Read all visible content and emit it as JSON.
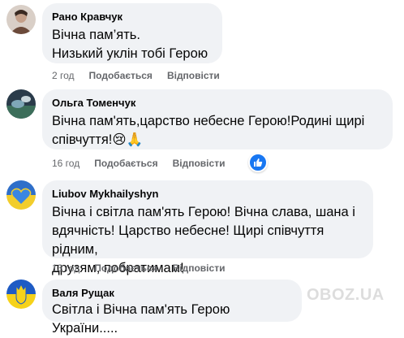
{
  "comments": [
    {
      "author": "Рано Кравчук",
      "lines": [
        "Вічна пам’ять.",
        "Низький уклін тобі Герою"
      ],
      "time": "2 год",
      "like_label": "Подобається",
      "reply_label": "Відповісти"
    },
    {
      "author": "Ольга Томенчук",
      "lines": [
        "Вічна пам'ять,царство небесне Герою!Родині щирі",
        "співчуття!😢🙏"
      ],
      "time": "16 год",
      "like_label": "Подобається",
      "reply_label": "Відповісти",
      "reaction_icon": "thumbs-up-icon"
    },
    {
      "author": "Liubov Mykhailyshyn",
      "lines": [
        "Вічна і світла пам'ять Герою! Вічна слава, шана і",
        "вдячність! Царство небесне! Щирі співчуття рідним,",
        "друзям, побратимам!"
      ],
      "time": "13 год",
      "like_label": "Подобається",
      "reply_label": "Відповісти"
    },
    {
      "author": "Валя Рущак",
      "lines": [
        "Світла і Вічна пам'ять Герою України....."
      ]
    }
  ],
  "watermark": "OBOZ.UA",
  "colors": {
    "bubble": "#f0f2f5",
    "meta": "#65676b",
    "like_blue": "#1877f2"
  }
}
